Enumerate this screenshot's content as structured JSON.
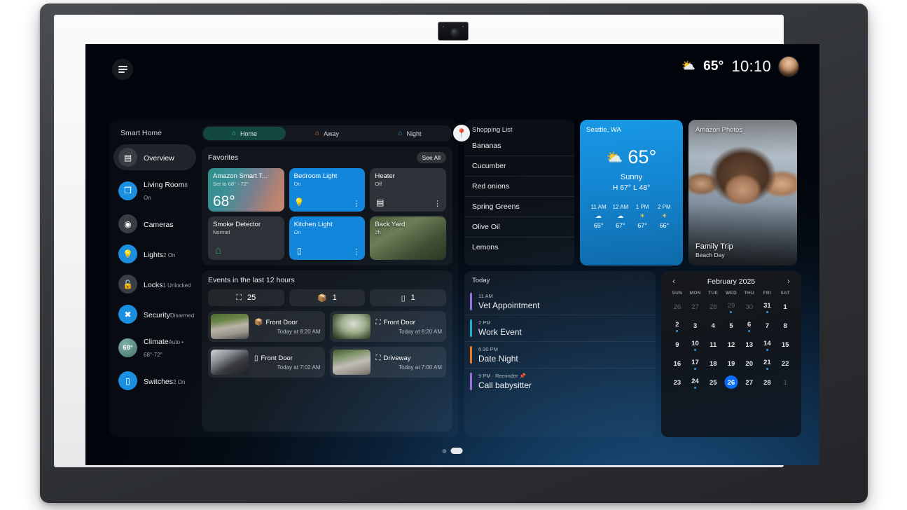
{
  "status_bar": {
    "weather_icon": "partly-sunny",
    "temperature": "65°",
    "time": "10:10",
    "menu_icon": "hamburger-menu-icon",
    "avatar": "user-avatar"
  },
  "sidebar": {
    "title": "Smart Home",
    "items": [
      {
        "label": "Overview",
        "sub": "",
        "icon": "dashboard-icon",
        "active": true
      },
      {
        "label": "Living Room",
        "sub": "8 On",
        "icon": "room-icon",
        "active": false
      },
      {
        "label": "Cameras",
        "sub": "",
        "icon": "camera-icon",
        "active": false
      },
      {
        "label": "Lights",
        "sub": "2 On",
        "icon": "bulb-icon",
        "active": false
      },
      {
        "label": "Locks",
        "sub": "1 Unlocked",
        "icon": "lock-open-icon",
        "active": false
      },
      {
        "label": "Security",
        "sub": "Disarmed",
        "icon": "shield-icon",
        "active": false
      },
      {
        "label": "Climate",
        "sub": "Auto • 68°-72°",
        "icon": "thermostat-icon",
        "badge": "68°",
        "active": false
      },
      {
        "label": "Switches",
        "sub": "2 On",
        "icon": "switch-icon",
        "active": false
      }
    ]
  },
  "modes": {
    "tabs": [
      {
        "label": "Home",
        "icon": "home-icon",
        "active": true
      },
      {
        "label": "Away",
        "icon": "away-icon",
        "active": false
      },
      {
        "label": "Night",
        "icon": "night-icon",
        "active": false
      }
    ],
    "geo_button_icon": "location-pin-icon"
  },
  "favorites": {
    "title": "Favorites",
    "see_all": "See All",
    "cards": [
      {
        "name": "Amazon Smart T...",
        "state": "Set to 68° - 72°",
        "big": "68°",
        "style": "thermostat",
        "icon": "",
        "menu": false
      },
      {
        "name": "Bedroom Light",
        "state": "On",
        "big": "",
        "style": "on",
        "icon": "bulb-icon",
        "menu": true
      },
      {
        "name": "Heater",
        "state": "Off",
        "big": "",
        "style": "off",
        "icon": "heater-icon",
        "menu": true
      },
      {
        "name": "Smoke Detector",
        "state": "Normal",
        "big": "",
        "style": "off",
        "icon": "home-outline-icon",
        "menu": false
      },
      {
        "name": "Kitchen Light",
        "state": "On",
        "big": "",
        "style": "on",
        "icon": "switch-icon",
        "menu": true
      },
      {
        "name": "Back Yard",
        "state": "2h",
        "big": "",
        "style": "camera",
        "icon": "",
        "menu": false
      }
    ]
  },
  "events": {
    "title": "Events in the last 12 hours",
    "chips": [
      {
        "icon": "person-detect-icon",
        "count": "25"
      },
      {
        "icon": "package-icon",
        "count": "1"
      },
      {
        "icon": "doorbell-icon",
        "count": "1"
      }
    ],
    "rows": [
      {
        "icon": "package-icon",
        "place": "Front Door",
        "time": "Today at 8:20 AM",
        "thumb": "a"
      },
      {
        "icon": "person-detect-icon",
        "place": "Front Door",
        "time": "Today at 8:20 AM",
        "thumb": "b"
      },
      {
        "icon": "doorbell-icon",
        "place": "Front Door",
        "time": "Today at 7:02 AM",
        "thumb": "c"
      },
      {
        "icon": "person-detect-icon",
        "place": "Driveway",
        "time": "Today at 7:00 AM",
        "thumb": "d"
      }
    ]
  },
  "shopping_list": {
    "title": "Shopping List",
    "items": [
      "Bananas",
      "Cucumber",
      "Red onions",
      "Spring Greens",
      "Olive Oil",
      "Lemons"
    ]
  },
  "weather": {
    "location": "Seattle, WA",
    "icon": "partly-sunny",
    "temperature": "65°",
    "condition": "Sunny",
    "high_low": "H 67°  L 48°",
    "hourly": [
      {
        "time": "11 AM",
        "icon": "cloudy",
        "temp": "65°"
      },
      {
        "time": "12 AM",
        "icon": "cloudy",
        "temp": "67°"
      },
      {
        "time": "1 PM",
        "icon": "sunny",
        "temp": "67°"
      },
      {
        "time": "2 PM",
        "icon": "sunny",
        "temp": "66°"
      }
    ]
  },
  "photos": {
    "header": "Amazon Photos",
    "caption": "Family Trip",
    "subcaption": "Beach Day"
  },
  "agenda": {
    "title": "Today",
    "items": [
      {
        "when": "11 AM",
        "what": "Vet Appointment",
        "color": "#9b6fe0"
      },
      {
        "when": "2 PM",
        "what": "Work Event",
        "color": "#17b5c9"
      },
      {
        "when": "6:30 PM",
        "what": "Date Night",
        "color": "#ef7a1e"
      },
      {
        "when": "9 PM · Reminder 📌",
        "what": "Call babysitter",
        "color": "#9b6fe0"
      }
    ]
  },
  "calendar": {
    "prev_icon": "chevron-left-icon",
    "next_icon": "chevron-right-icon",
    "title": "February 2025",
    "dow": [
      "SUN",
      "MON",
      "TUE",
      "WED",
      "THU",
      "FRI",
      "SAT"
    ],
    "days": [
      {
        "n": "26",
        "muted": true,
        "dot": false,
        "today": false
      },
      {
        "n": "27",
        "muted": true,
        "dot": false,
        "today": false
      },
      {
        "n": "28",
        "muted": true,
        "dot": false,
        "today": false
      },
      {
        "n": "29",
        "muted": true,
        "dot": true,
        "today": false
      },
      {
        "n": "30",
        "muted": true,
        "dot": false,
        "today": false
      },
      {
        "n": "31",
        "muted": false,
        "dot": true,
        "today": false
      },
      {
        "n": "1",
        "muted": false,
        "dot": false,
        "today": false
      },
      {
        "n": "2",
        "muted": false,
        "dot": true,
        "today": false
      },
      {
        "n": "3",
        "muted": false,
        "dot": false,
        "today": false
      },
      {
        "n": "4",
        "muted": false,
        "dot": false,
        "today": false
      },
      {
        "n": "5",
        "muted": false,
        "dot": false,
        "today": false
      },
      {
        "n": "6",
        "muted": false,
        "dot": true,
        "today": false
      },
      {
        "n": "7",
        "muted": false,
        "dot": false,
        "today": false
      },
      {
        "n": "8",
        "muted": false,
        "dot": false,
        "today": false
      },
      {
        "n": "9",
        "muted": false,
        "dot": false,
        "today": false
      },
      {
        "n": "10",
        "muted": false,
        "dot": true,
        "today": false
      },
      {
        "n": "11",
        "muted": false,
        "dot": false,
        "today": false
      },
      {
        "n": "12",
        "muted": false,
        "dot": false,
        "today": false
      },
      {
        "n": "13",
        "muted": false,
        "dot": false,
        "today": false
      },
      {
        "n": "14",
        "muted": false,
        "dot": true,
        "today": false
      },
      {
        "n": "15",
        "muted": false,
        "dot": false,
        "today": false
      },
      {
        "n": "16",
        "muted": false,
        "dot": false,
        "today": false
      },
      {
        "n": "17",
        "muted": false,
        "dot": true,
        "today": false
      },
      {
        "n": "18",
        "muted": false,
        "dot": false,
        "today": false
      },
      {
        "n": "19",
        "muted": false,
        "dot": false,
        "today": false
      },
      {
        "n": "20",
        "muted": false,
        "dot": false,
        "today": false
      },
      {
        "n": "21",
        "muted": false,
        "dot": true,
        "today": false
      },
      {
        "n": "22",
        "muted": false,
        "dot": false,
        "today": false
      },
      {
        "n": "23",
        "muted": false,
        "dot": false,
        "today": false
      },
      {
        "n": "24",
        "muted": false,
        "dot": true,
        "today": false
      },
      {
        "n": "25",
        "muted": false,
        "dot": false,
        "today": false
      },
      {
        "n": "26",
        "muted": false,
        "dot": false,
        "today": true
      },
      {
        "n": "27",
        "muted": false,
        "dot": false,
        "today": false
      },
      {
        "n": "28",
        "muted": false,
        "dot": false,
        "today": false
      },
      {
        "n": "1",
        "muted": true,
        "dot": false,
        "today": false
      }
    ]
  },
  "pagination": {
    "pages": 2,
    "current": 2
  },
  "colors": {
    "accent_blue": "#1286da",
    "mode_active": "#12483f",
    "today_blue": "#0a6efd",
    "event_dot": "#2f9ae8"
  }
}
